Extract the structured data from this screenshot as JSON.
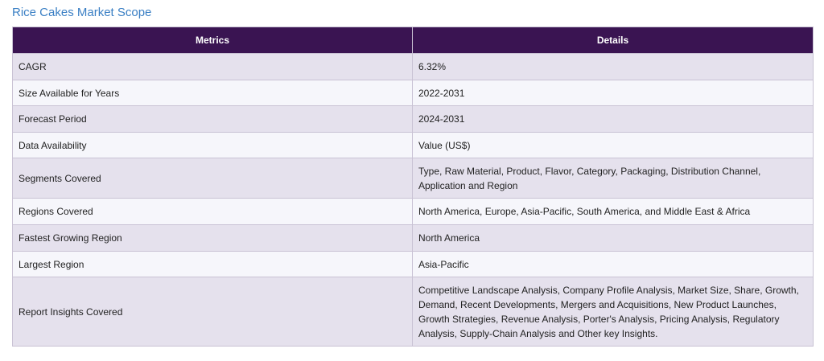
{
  "title": "Rice Cakes Market Scope",
  "table": {
    "headers": [
      "Metrics",
      "Details"
    ],
    "rows": [
      {
        "metric": "CAGR",
        "details": "6.32%"
      },
      {
        "metric": "Size Available for Years",
        "details": "2022-2031"
      },
      {
        "metric": "Forecast Period",
        "details": "2024-2031"
      },
      {
        "metric": "Data Availability",
        "details": "Value (US$)"
      },
      {
        "metric": "Segments Covered",
        "details": "Type, Raw Material, Product, Flavor, Category, Packaging, Distribution Channel, Application and Region"
      },
      {
        "metric": "Regions Covered",
        "details": "North America, Europe, Asia-Pacific, South America, and Middle East & Africa"
      },
      {
        "metric": "Fastest Growing Region",
        "details": "North America"
      },
      {
        "metric": "Largest Region",
        "details": "Asia-Pacific"
      },
      {
        "metric": "Report Insights Covered",
        "details": "Competitive Landscape Analysis, Company Profile Analysis, Market Size, Share, Growth, Demand, Recent Developments, Mergers and Acquisitions, New Product Launches, Growth Strategies, Revenue Analysis, Porter's Analysis, Pricing Analysis, Regulatory Analysis, Supply-Chain Analysis and Other key Insights."
      }
    ]
  },
  "colors": {
    "title": "#3a7fc4",
    "header_bg": "#3a1452",
    "row_shade": "#e5e1ed",
    "row_light": "#f6f6fb"
  }
}
